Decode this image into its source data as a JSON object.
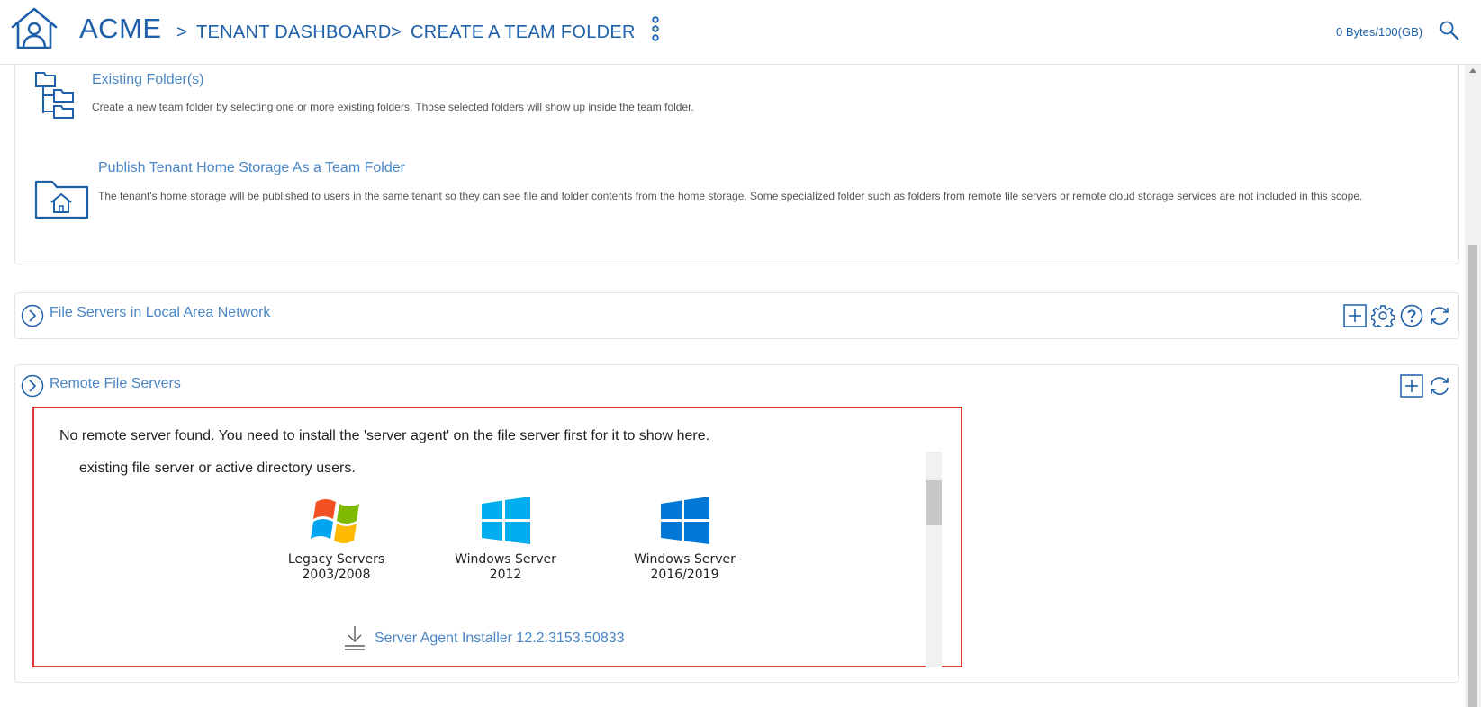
{
  "header": {
    "brand": "ACME",
    "breadcrumbs": [
      {
        "sep": ">",
        "label": "TENANT DASHBOARD"
      },
      {
        "sep": ">",
        "label": "CREATE A TEAM FOLDER"
      }
    ],
    "storage": "0 Bytes/100(GB)",
    "icons": [
      "home-icon",
      "kebab-menu-icon",
      "search-icon"
    ]
  },
  "options": [
    {
      "title": "Existing Folder(s)",
      "description": "Create a new team folder by selecting one or more existing folders. Those selected folders will show up inside the team folder.",
      "icon": "folder-tree-icon"
    },
    {
      "title": "Publish Tenant Home Storage As a Team Folder",
      "description": "The tenant's home storage will be published to users in the same tenant so they can see file and folder contents from the home storage. Some specialized folder such as folders from remote file servers or remote cloud storage services are not included in this scope.",
      "icon": "home-folder-icon"
    }
  ],
  "sections": {
    "lan": {
      "title": "File Servers in Local Area Network",
      "tools": [
        "add-icon",
        "gear-icon",
        "help-icon",
        "refresh-icon"
      ]
    },
    "remote": {
      "title": "Remote File Servers",
      "tools": [
        "add-icon",
        "refresh-icon"
      ]
    }
  },
  "remote_content": {
    "message": "No remote server found. You need to install the 'server agent' on the file server first for it to show here.",
    "line2": "existing file server or active directory users.",
    "os": [
      {
        "line1": "Legacy Servers",
        "line2": "2003/2008",
        "icon": "windows-legacy-logo"
      },
      {
        "line1": "Windows Server",
        "line2": "2012",
        "icon": "windows-2012-logo"
      },
      {
        "line1": "Windows Server",
        "line2": "2016/2019",
        "icon": "windows-2016-logo"
      }
    ],
    "installer": "Server Agent Installer 12.2.3153.50833"
  },
  "colors": {
    "brand_blue": "#1d5fa8",
    "link_blue": "#4a86c5",
    "highlight_red": "#e0363a",
    "win_2012": "#00adef",
    "win_2016": "#0078d7"
  }
}
